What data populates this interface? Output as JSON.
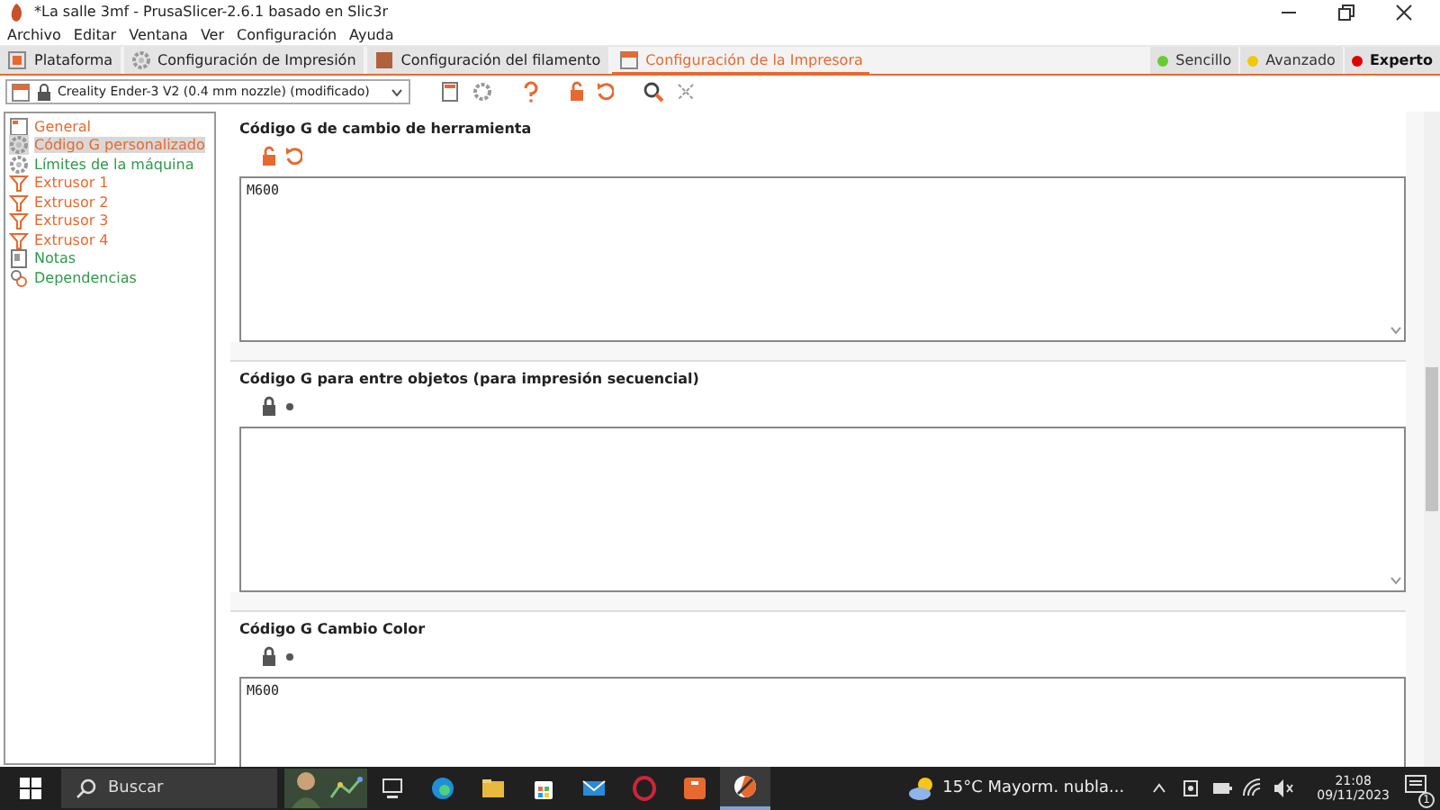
{
  "window": {
    "title": "*La salle 3mf - PrusaSlicer-2.6.1 basado en Slic3r"
  },
  "menu": [
    "Archivo",
    "Editar",
    "Ventana",
    "Ver",
    "Configuración",
    "Ayuda"
  ],
  "tabs": [
    {
      "label": "Plataforma",
      "selected": false
    },
    {
      "label": "Configuración de Impresión",
      "selected": false
    },
    {
      "label": "Configuración del filamento",
      "selected": false
    },
    {
      "label": "Configuración de la Impresora",
      "selected": true
    }
  ],
  "modes": [
    {
      "label": "Sencillo",
      "color": "#66cc33",
      "selected": false
    },
    {
      "label": "Avanzado",
      "color": "#f0c808",
      "selected": false
    },
    {
      "label": "Experto",
      "color": "#e00000",
      "selected": true
    }
  ],
  "preset": {
    "value": "Creality Ender-3 V2 (0.4 mm nozzle) (modificado)"
  },
  "sidebar": {
    "items": [
      {
        "label": "General",
        "color": "#e8692f",
        "selected": false
      },
      {
        "label": "Código G personalizado",
        "color": "#e8692f",
        "selected": true
      },
      {
        "label": "Límites de la máquina",
        "color": "#2e9a4a",
        "selected": false
      },
      {
        "label": "Extrusor 1",
        "color": "#e8692f",
        "selected": false
      },
      {
        "label": "Extrusor 2",
        "color": "#e8692f",
        "selected": false
      },
      {
        "label": "Extrusor 3",
        "color": "#e8692f",
        "selected": false
      },
      {
        "label": "Extrusor 4",
        "color": "#e8692f",
        "selected": false
      },
      {
        "label": "Notas",
        "color": "#2e9a4a",
        "selected": false
      },
      {
        "label": "Dependencias",
        "color": "#2e9a4a",
        "selected": false
      }
    ]
  },
  "sections": [
    {
      "title": "Código G de cambio de herramienta",
      "locked": false,
      "modified": true,
      "value": "M600"
    },
    {
      "title": "Código G para entre objetos (para impresión secuencial)",
      "locked": true,
      "modified": false
    },
    {
      "title": "Código G Cambio Color",
      "locked": true,
      "modified": false,
      "value": "M600"
    }
  ],
  "taskbar": {
    "search": {
      "placeholder": "Buscar"
    },
    "weather": "15°C  Mayorm. nubla...",
    "time": "21:08",
    "date": "09/11/2023",
    "notifications": "1"
  }
}
